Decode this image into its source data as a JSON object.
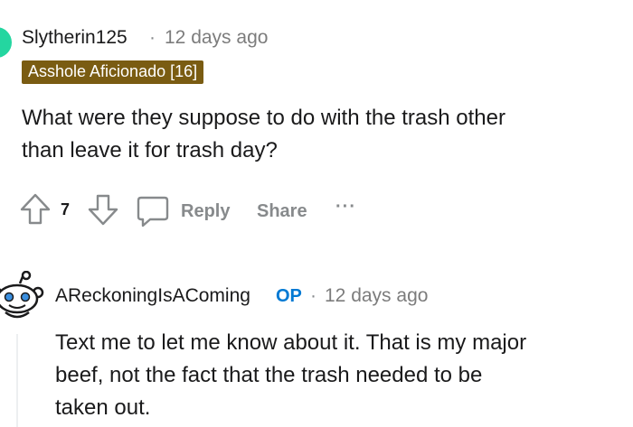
{
  "comment1": {
    "username": "Slytherin125",
    "separator": "·",
    "time": "12 days ago",
    "flair": "Asshole Aficionado [16]",
    "body_line1": "What were they suppose to do with the trash other",
    "body_line2": "than leave it for trash day?",
    "votes": "7",
    "reply_label": "Reply",
    "share_label": "Share",
    "more_label": "···"
  },
  "comment2": {
    "username": "AReckoningIsAComing",
    "op_badge": "OP",
    "separator": "·",
    "time": "12 days ago",
    "body_line1": "Text me to let me know about it. That is my major",
    "body_line2": "beef, not the fact that the trash needed to be",
    "body_line3": "taken out."
  },
  "colors": {
    "flair_bg": "#7a5c12",
    "op_blue": "#0079d3",
    "action_gray": "#878a8c",
    "avatar_green": "#24d6a0"
  },
  "icons": {
    "upvote": "arrow-up-outline-icon",
    "downvote": "arrow-down-outline-icon",
    "reply": "speech-bubble-icon",
    "avatar2": "reddit-snoo-avatar-icon"
  }
}
